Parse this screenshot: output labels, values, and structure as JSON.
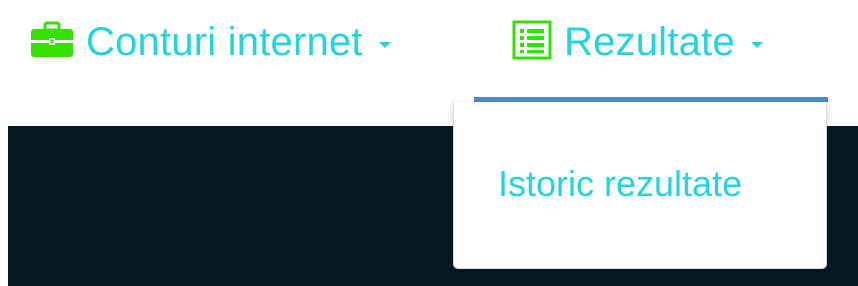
{
  "nav": {
    "items": [
      {
        "label": "Conturi internet",
        "icon": "briefcase-icon"
      },
      {
        "label": "Rezultate",
        "icon": "list-icon"
      }
    ]
  },
  "dropdown": {
    "items": [
      {
        "label": "Istoric rezultate"
      }
    ]
  },
  "colors": {
    "link": "#22d4dc",
    "icon": "#33e000",
    "underline": "#4c8ccd",
    "dark_panel": "#061a22"
  }
}
